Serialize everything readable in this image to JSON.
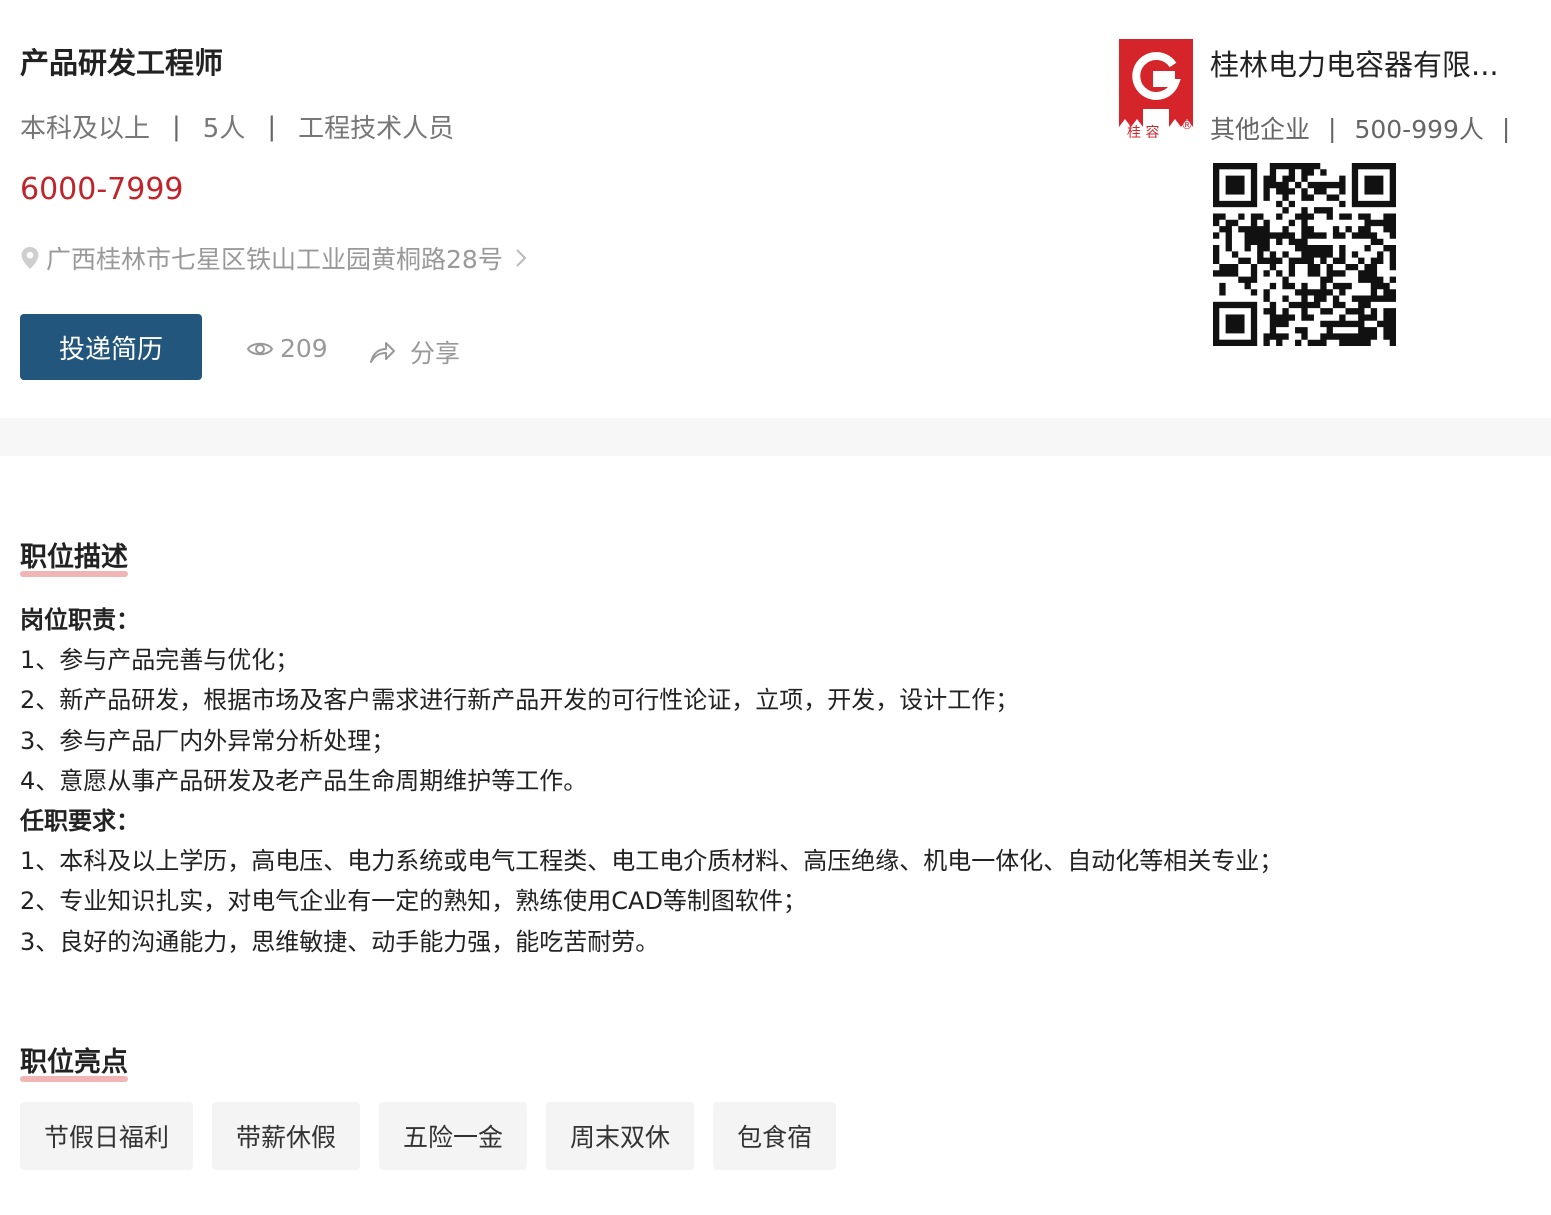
{
  "job": {
    "title": "产品研发工程师",
    "education": "本科及以上",
    "headcount": "5人",
    "category": "工程技术人员",
    "separator": "|",
    "salary": "6000-7999",
    "address": "广西桂林市七星区铁山工业园黄桐路28号",
    "apply_label": "投递简历",
    "views": "209",
    "share_label": "分享"
  },
  "company": {
    "name": "桂林电力电容器有限...",
    "type": "其他企业",
    "size": "500-999人",
    "logo_text": "桂 容",
    "logo_mark": "®",
    "brand_color": "#d6242b"
  },
  "description": {
    "title": "职位描述",
    "duties_heading": "岗位职责：",
    "duties": [
      "1、参与产品完善与优化；",
      "2、新产品研发，根据市场及客户需求进行新产品开发的可行性论证，立项，开发，设计工作；",
      "3、参与产品厂内外异常分析处理；",
      "4、意愿从事产品研发及老产品生命周期维护等工作。"
    ],
    "requirements_heading": "任职要求：",
    "requirements": [
      "1、本科及以上学历，高电压、电力系统或电气工程类、电工电介质材料、高压绝缘、机电一体化、自动化等相关专业；",
      "2、专业知识扎实，对电气企业有一定的熟知，熟练使用CAD等制图软件；",
      "3、良好的沟通能力，思维敏捷、动手能力强，能吃苦耐劳。"
    ]
  },
  "highlights": {
    "title": "职位亮点",
    "tags": [
      "节假日福利",
      "带薪休假",
      "五险一金",
      "周末双休",
      "包食宿"
    ]
  },
  "colors": {
    "accent": "#23567c",
    "salary": "#c0252b",
    "underline": "#f0b5b5"
  }
}
